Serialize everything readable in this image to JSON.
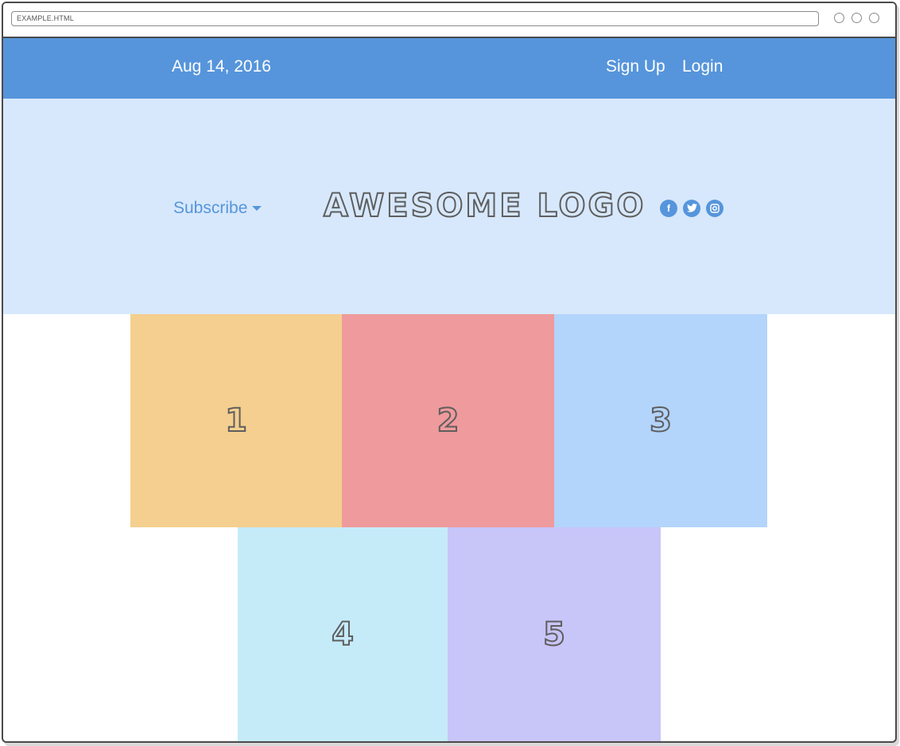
{
  "browser": {
    "address": "EXAMPLE.HTML"
  },
  "topbar": {
    "date": "Aug 14, 2016",
    "signup_label": "Sign Up",
    "login_label": "Login",
    "background": "#5695db"
  },
  "hero": {
    "subscribe_label": "Subscribe",
    "logo_text": "AWESOME LOGO",
    "background": "#d7e8fc",
    "social": [
      {
        "icon": "facebook-icon",
        "glyph": "f"
      },
      {
        "icon": "twitter-icon"
      },
      {
        "icon": "instagram-icon"
      }
    ]
  },
  "tiles": [
    {
      "label": "1",
      "color": "#f4cf8f"
    },
    {
      "label": "2",
      "color": "#ef9a9c"
    },
    {
      "label": "3",
      "color": "#b3d4fb"
    },
    {
      "label": "4",
      "color": "#c5ebf9"
    },
    {
      "label": "5",
      "color": "#c8c5f9"
    }
  ]
}
